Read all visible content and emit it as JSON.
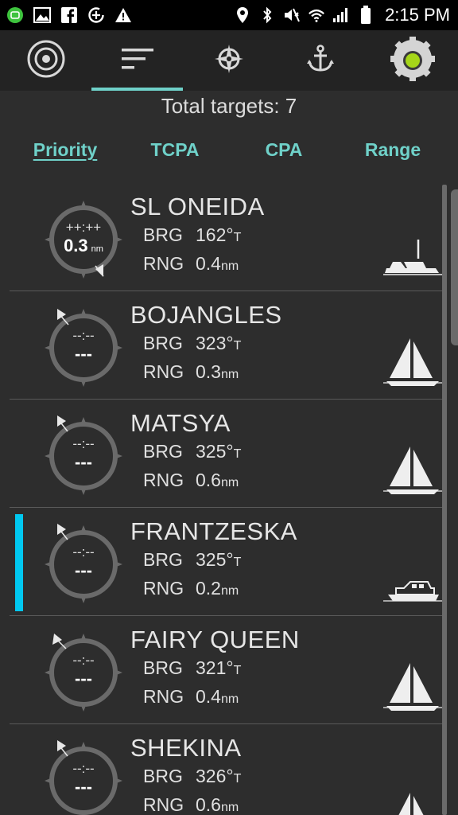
{
  "status_bar": {
    "time": "2:15 PM",
    "left_icons": [
      "messenger-notification-icon",
      "image-notification-icon",
      "facebook-icon",
      "data-saver-icon",
      "warning-icon"
    ],
    "right_icons": [
      "location-icon",
      "bluetooth-icon",
      "mute-icon",
      "wifi-icon",
      "signal-icon",
      "battery-icon"
    ]
  },
  "toolbar": {
    "items": [
      "radar-target-icon",
      "list-sort-icon",
      "compass-rose-icon",
      "anchor-icon",
      "settings-gear-icon"
    ],
    "active_index": 1,
    "accent_color": "#6fd1c9",
    "status_indicator_color": "#a6d619"
  },
  "summary": {
    "total_targets": "Total targets: 7"
  },
  "sort_tabs": [
    {
      "label": "Priority",
      "active": true
    },
    {
      "label": "TCPA",
      "active": false
    },
    {
      "label": "CPA",
      "active": false
    },
    {
      "label": "Range",
      "active": false
    }
  ],
  "targets": [
    {
      "name": "SL ONEIDA",
      "tcpa": "++:++",
      "cpa": "0.3",
      "cpa_unit": "nm",
      "brg_label": "BRG",
      "brg": "162°",
      "brg_ref": "T",
      "rng_label": "RNG",
      "rng": "0.4",
      "rng_unit": "nm",
      "vessel": "motorboat",
      "selected": false
    },
    {
      "name": "BOJANGLES",
      "tcpa": "--:--",
      "cpa": "---",
      "cpa_unit": "",
      "brg_label": "BRG",
      "brg": "323°",
      "brg_ref": "T",
      "rng_label": "RNG",
      "rng": "0.3",
      "rng_unit": "nm",
      "vessel": "sailboat",
      "selected": false
    },
    {
      "name": "MATSYA",
      "tcpa": "--:--",
      "cpa": "---",
      "cpa_unit": "",
      "brg_label": "BRG",
      "brg": "325°",
      "brg_ref": "T",
      "rng_label": "RNG",
      "rng": "0.6",
      "rng_unit": "nm",
      "vessel": "sailboat",
      "selected": false
    },
    {
      "name": "FRANTZESKA",
      "tcpa": "--:--",
      "cpa": "---",
      "cpa_unit": "",
      "brg_label": "BRG",
      "brg": "325°",
      "brg_ref": "T",
      "rng_label": "RNG",
      "rng": "0.2",
      "rng_unit": "nm",
      "vessel": "cruiser",
      "selected": true
    },
    {
      "name": "FAIRY QUEEN",
      "tcpa": "--:--",
      "cpa": "---",
      "cpa_unit": "",
      "brg_label": "BRG",
      "brg": "321°",
      "brg_ref": "T",
      "rng_label": "RNG",
      "rng": "0.4",
      "rng_unit": "nm",
      "vessel": "sailboat",
      "selected": false
    },
    {
      "name": "SHEKINA",
      "tcpa": "--:--",
      "cpa": "---",
      "cpa_unit": "",
      "brg_label": "BRG",
      "brg": "326°",
      "brg_ref": "T",
      "rng_label": "RNG",
      "rng": "0.6",
      "rng_unit": "nm",
      "vessel": "sailboat",
      "selected": false
    }
  ]
}
